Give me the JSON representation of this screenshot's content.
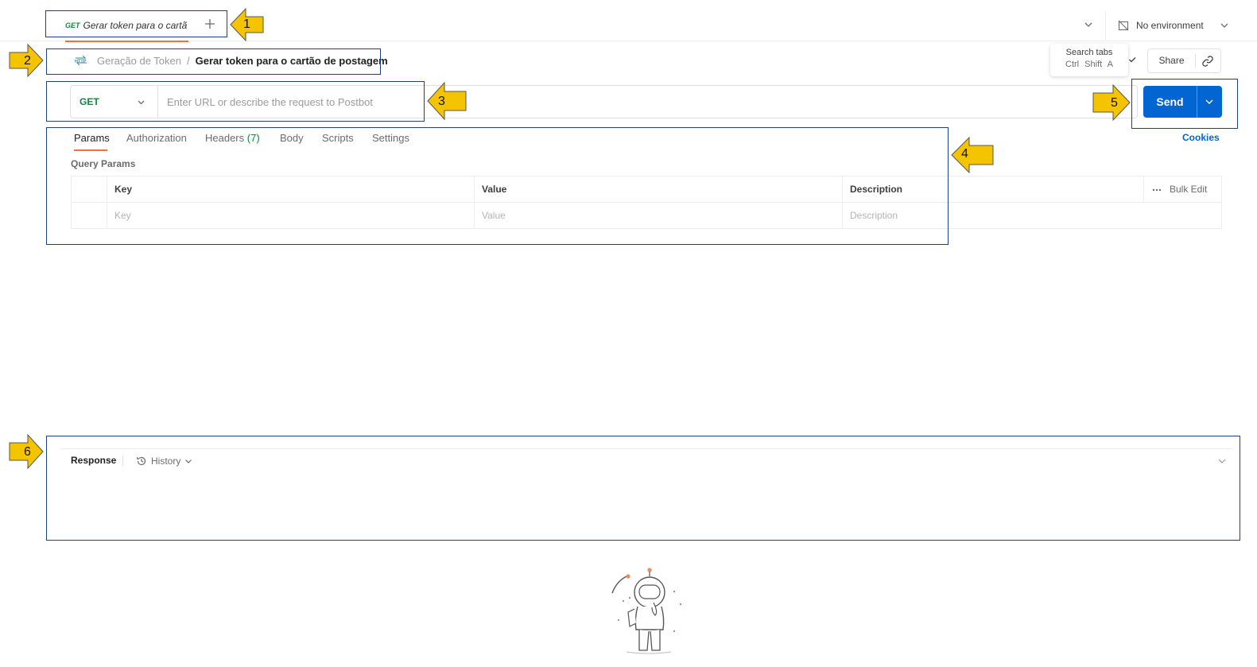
{
  "tab": {
    "method": "GET",
    "name": "Gerar token para o cartã"
  },
  "environment": {
    "label": "No environment"
  },
  "breadcrumb": {
    "collection": "Geração de Token",
    "separator": "/",
    "request": "Gerar token para o cartão de postagem"
  },
  "tooltip": {
    "title": "Search tabs",
    "shortcut": "Ctrl Shift A"
  },
  "toolbar": {
    "share_label": "Share"
  },
  "url_bar": {
    "method": "GET",
    "value": "",
    "placeholder": "Enter URL or describe the request to Postbot"
  },
  "send": {
    "label": "Send"
  },
  "request_tabs": {
    "params": "Params",
    "authorization": "Authorization",
    "headers": "Headers",
    "headers_count": "(7)",
    "body": "Body",
    "scripts": "Scripts",
    "settings": "Settings",
    "cookies": "Cookies"
  },
  "query_params": {
    "title": "Query Params",
    "columns": [
      "Key",
      "Value",
      "Description"
    ],
    "bulk_edit": "Bulk Edit",
    "placeholder_row": [
      "Key",
      "Value",
      "Description"
    ]
  },
  "response": {
    "title": "Response",
    "history": "History"
  },
  "annotations": [
    "1",
    "2",
    "3",
    "4",
    "5",
    "6"
  ],
  "colors": {
    "accent": "#ff6c37",
    "send": "#0265d2",
    "method": "#0b8a3a",
    "annotation_box": "#1f3f86",
    "annotation_arrow": "#f5c400"
  }
}
